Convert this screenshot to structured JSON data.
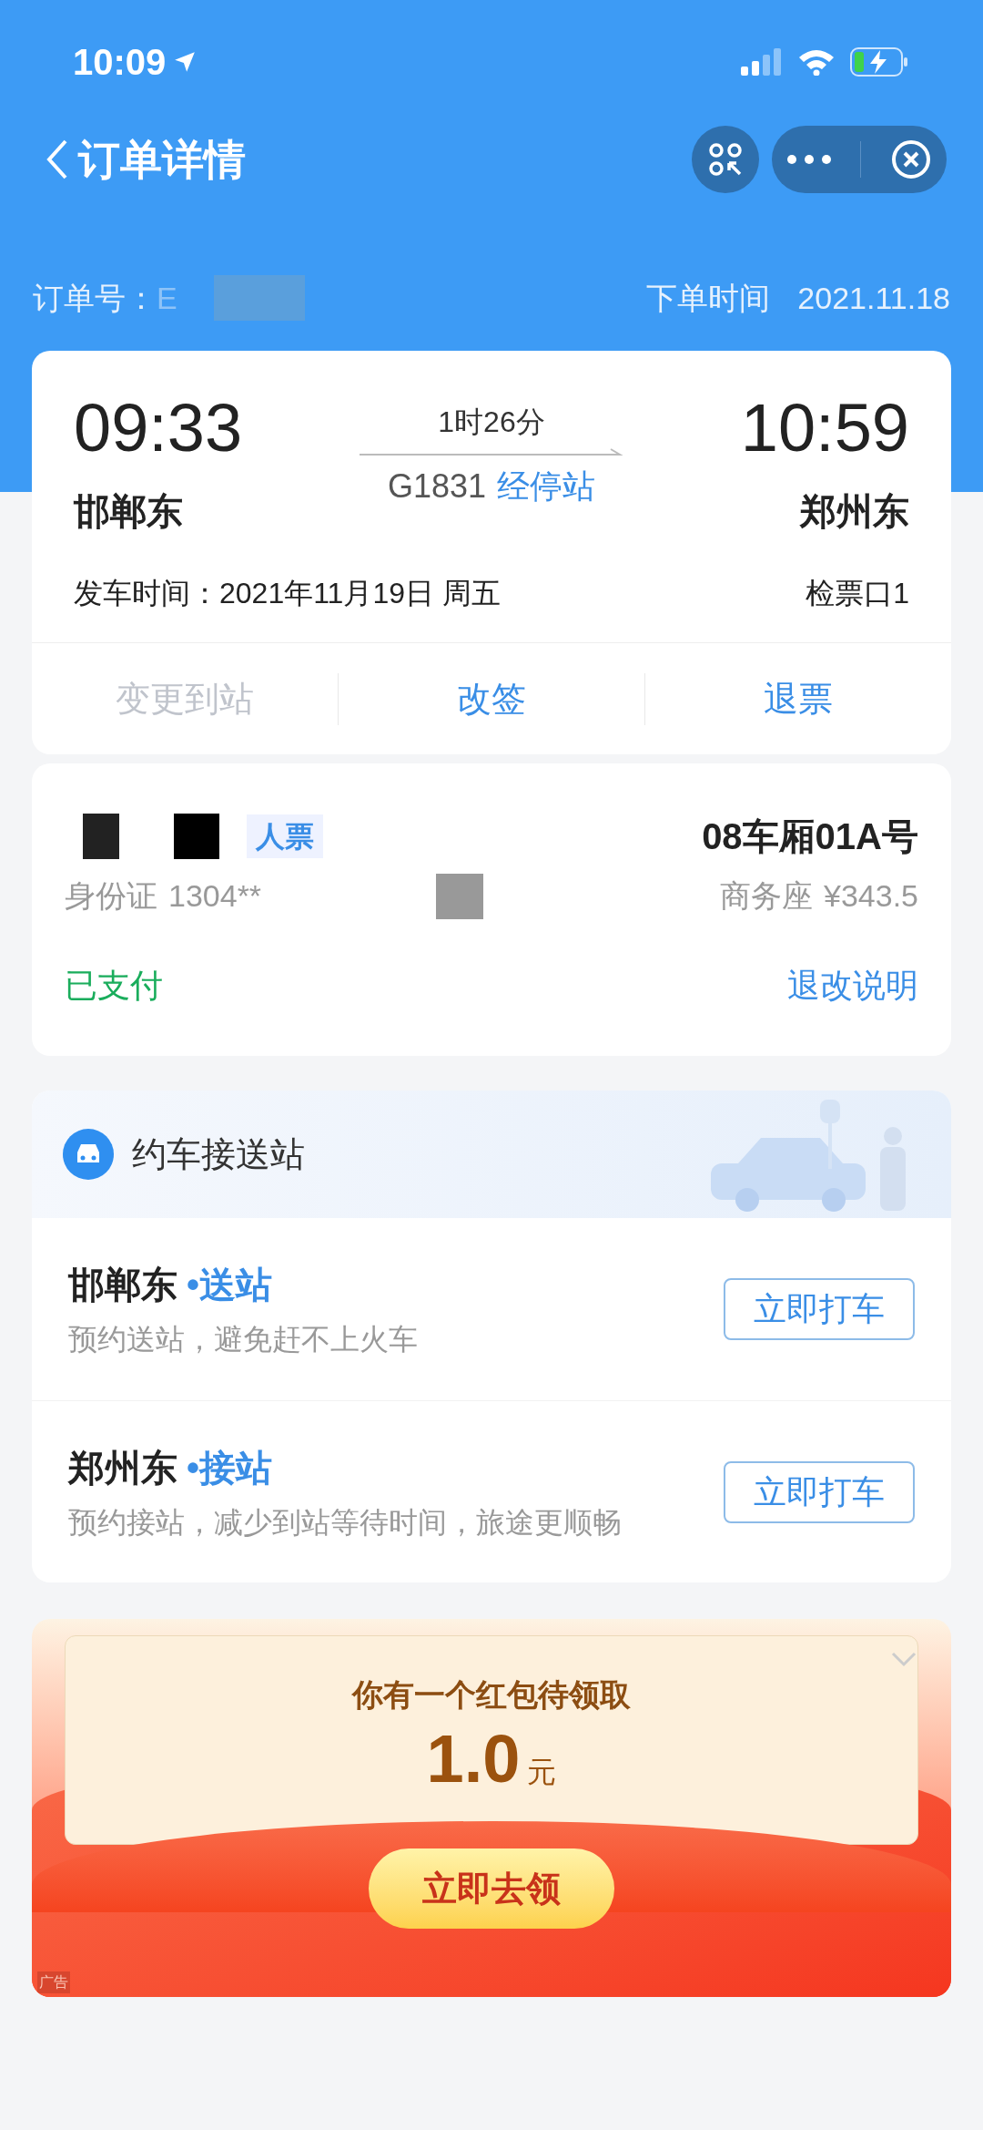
{
  "status_bar": {
    "time": "10:09"
  },
  "nav": {
    "title": "订单详情"
  },
  "order": {
    "number_label": "订单号：",
    "number_visible": "E",
    "time_label": "下单时间",
    "time": "2021.11.18"
  },
  "trip": {
    "depart_time": "09:33",
    "depart_station": "邯郸东",
    "duration": "1时26分",
    "train": "G1831",
    "stops_link": "经停站",
    "arrive_time": "10:59",
    "arrive_station": "郑州东",
    "date_label": "发车时间：",
    "date": "2021年11月19日 周五",
    "gate": "检票口1",
    "actions": [
      {
        "label": "变更到站",
        "disabled": true
      },
      {
        "label": "改签",
        "disabled": false
      },
      {
        "label": "退票",
        "disabled": false
      }
    ]
  },
  "passenger": {
    "ticket_type": "人票",
    "id_label": "身份证",
    "id": "1304**",
    "seat": "08车厢01A号",
    "seat_class": "商务座",
    "price": "¥343.5",
    "status": "已支付",
    "rules_link": "退改说明"
  },
  "car_service": {
    "title": "约车接送站",
    "rows": [
      {
        "station": "邯郸东",
        "tag": "•送站",
        "desc": "预约送站，避免赶不上火车",
        "button": "立即打车"
      },
      {
        "station": "郑州东",
        "tag": "•接站",
        "desc": "预约接站，减少到站等待时间，旅途更顺畅",
        "button": "立即打车"
      }
    ]
  },
  "red_packet": {
    "title": "你有一个红包待领取",
    "amount": "1.0",
    "unit": "元",
    "button": "立即去领",
    "ad_label": "广告"
  }
}
